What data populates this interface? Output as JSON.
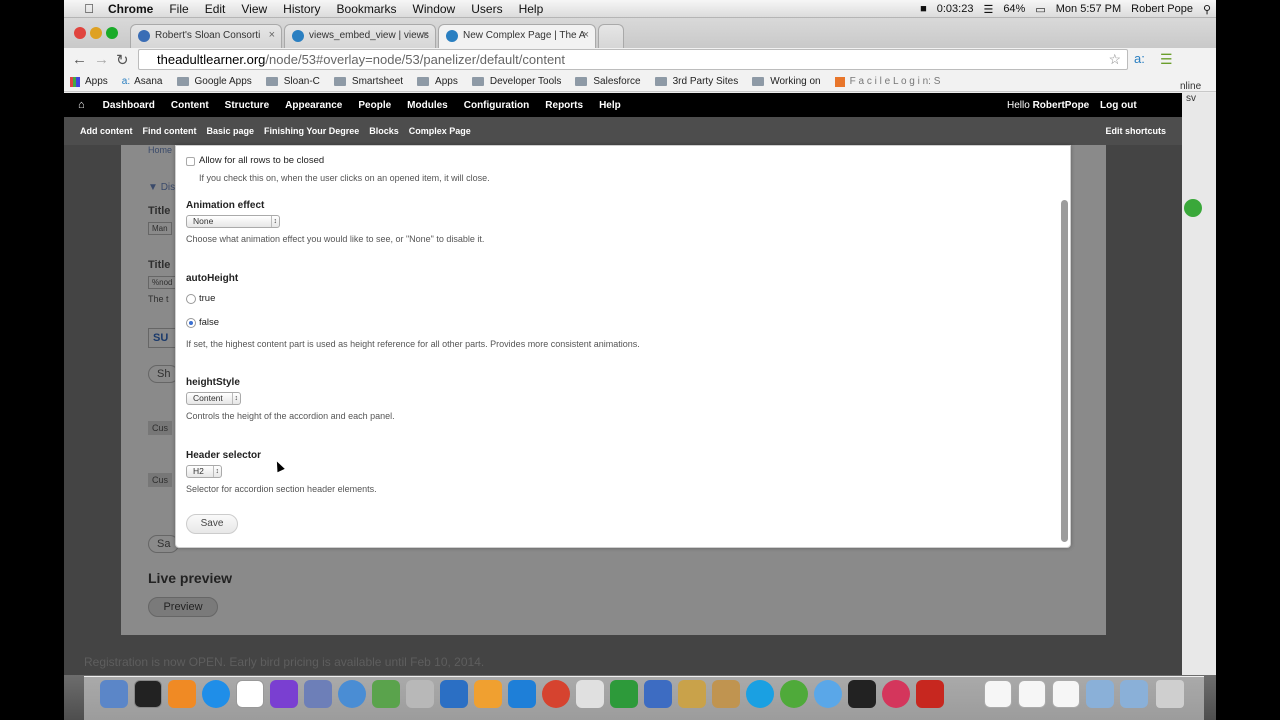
{
  "menubar": {
    "app": "Chrome",
    "items": [
      "File",
      "Edit",
      "View",
      "History",
      "Bookmarks",
      "Window",
      "Users",
      "Help"
    ],
    "recording_time": "0:03:23",
    "battery": "64%",
    "clock": "Mon 5:57 PM",
    "user": "Robert Pope"
  },
  "tabs": [
    {
      "label": "Robert's Sloan Consorti",
      "active": false
    },
    {
      "label": "views_embed_view | views",
      "active": false
    },
    {
      "label": "New Complex Page | The A",
      "active": true
    }
  ],
  "address": {
    "host": "theadultlearner.org",
    "path": "/node/53#overlay=node/53/panelizer/default/content"
  },
  "bookmarks": [
    "Apps",
    "Asana",
    "Google Apps",
    "Sloan-C",
    "Smartsheet",
    "Apps",
    "Developer Tools",
    "Salesforce",
    "3rd Party Sites",
    "Working on",
    "F a c i l e L o g i n: S"
  ],
  "admin_menu": {
    "items": [
      "Dashboard",
      "Content",
      "Structure",
      "Appearance",
      "People",
      "Modules",
      "Configuration",
      "Reports",
      "Help"
    ],
    "hello_prefix": "Hello ",
    "username": "RobertPope",
    "logout": "Log out"
  },
  "shortcuts": {
    "items": [
      "Add content",
      "Find content",
      "Basic page",
      "Finishing Your Degree",
      "Blocks",
      "Complex Page"
    ],
    "edit": "Edit shortcuts"
  },
  "background": {
    "home": "Home",
    "dis": "Dis",
    "title1": "Title",
    "man": "Man",
    "title2": "Title",
    "node": "%nod",
    "the": "The t",
    "su": "SU",
    "sh": "Sh",
    "cus1": "Cus",
    "cus2": "Cus",
    "sa": "Sa",
    "live_preview": "Live preview",
    "preview_button": "Preview"
  },
  "side": {
    "line1": "nline",
    "line2": "sv"
  },
  "modal": {
    "allow_close_label": "Allow for all rows to be closed",
    "allow_close_desc": "If you check this on, when the user clicks on an opened item, it will close.",
    "animation_label": "Animation effect",
    "animation_value": "None",
    "animation_desc": "Choose what animation effect you would like to see, or \"None\" to disable it.",
    "autoheight_label": "autoHeight",
    "autoheight_true": "true",
    "autoheight_false": "false",
    "autoheight_desc": "If set, the highest content part is used as height reference for all other parts. Provides more consistent animations.",
    "heightstyle_label": "heightStyle",
    "heightstyle_value": "Content",
    "heightstyle_desc": "Controls the height of the accordion and each panel.",
    "header_label": "Header selector",
    "header_value": "H2",
    "header_desc": "Selector for accordion section header elements.",
    "save": "Save"
  },
  "dock_text": "Registration is now OPEN. Early bird pricing is available until Feb 10, 2014.",
  "colors": {
    "admin_bar": "#000000",
    "shortcut_bar": "#4d4d4d",
    "radio_selected": "#3b6fd1"
  }
}
